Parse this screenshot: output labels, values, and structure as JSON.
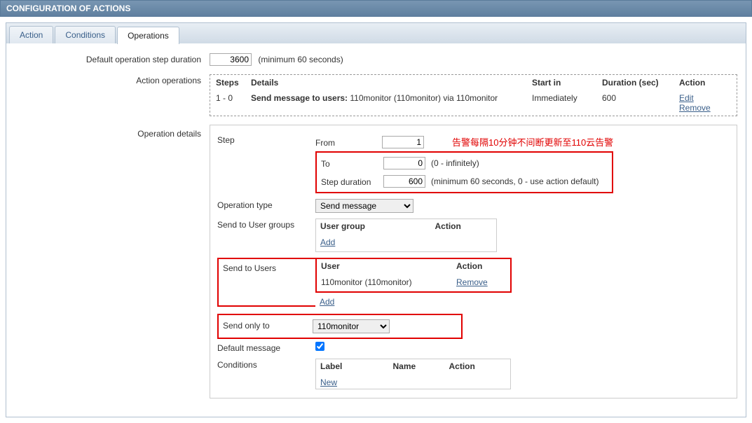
{
  "header": {
    "title": "CONFIGURATION OF ACTIONS"
  },
  "tabs": [
    {
      "label": "Action"
    },
    {
      "label": "Conditions"
    },
    {
      "label": "Operations"
    }
  ],
  "form": {
    "default_step_duration_label": "Default operation step duration",
    "default_step_duration_value": "3600",
    "default_step_duration_hint": "(minimum 60 seconds)",
    "action_operations_label": "Action operations",
    "operation_details_label": "Operation details"
  },
  "ops_table": {
    "cols": {
      "steps": "Steps",
      "details": "Details",
      "start": "Start in",
      "duration": "Duration (sec)",
      "action": "Action"
    },
    "row": {
      "steps": "1 - 0",
      "details_bold": "Send message to users:",
      "details_rest": " 110monitor (110monitor) via 110monitor",
      "start": "Immediately",
      "duration": "600",
      "edit": "Edit",
      "remove": "Remove"
    }
  },
  "details": {
    "step_label": "Step",
    "from_label": "From",
    "from_value": "1",
    "to_label": "To",
    "to_value": "0",
    "to_hint": "(0 - infinitely)",
    "dur_label": "Step duration",
    "dur_value": "600",
    "dur_hint": "(minimum 60 seconds, 0 - use action default)",
    "op_type_label": "Operation type",
    "op_type_value": "Send message",
    "send_groups_label": "Send to User groups",
    "groups_table": {
      "col1": "User group",
      "col2": "Action",
      "add": "Add"
    },
    "send_users_label": "Send to Users",
    "users_table": {
      "col1": "User",
      "col2": "Action",
      "user": "110monitor (110monitor)",
      "remove": "Remove",
      "add": "Add"
    },
    "send_only_label": "Send only to",
    "send_only_value": "110monitor",
    "default_msg_label": "Default message",
    "conditions_label": "Conditions",
    "conditions_table": {
      "col1": "Label",
      "col2": "Name",
      "col3": "Action",
      "new": "New"
    }
  },
  "annotation": "告警每隔10分钟不间断更新至110云告警"
}
